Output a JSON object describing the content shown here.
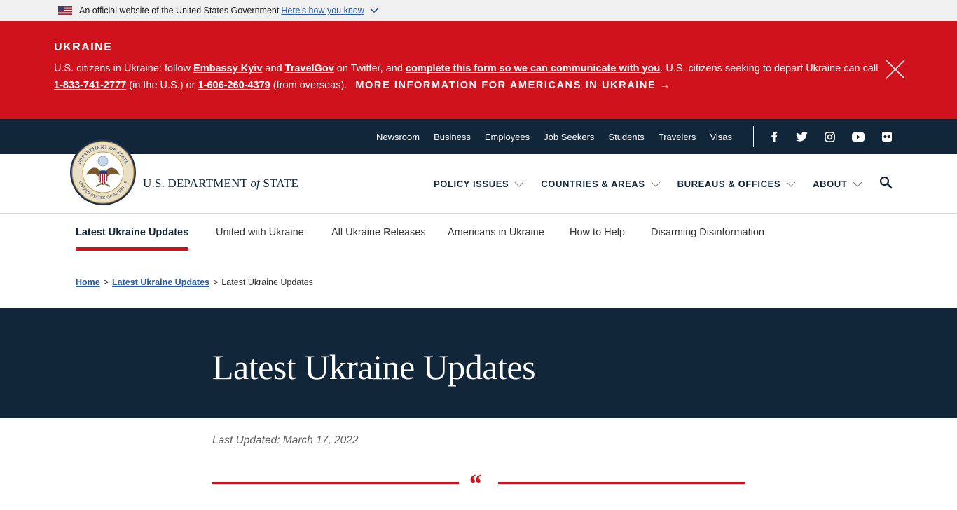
{
  "gov_banner": {
    "text": "An official website of the United States Government",
    "link_label": "Here's how you know"
  },
  "alert": {
    "title": "UKRAINE",
    "intro": "U.S. citizens in Ukraine: follow ",
    "link_embassy": "Embassy Kyiv",
    "and": " and ",
    "link_travelgov": "TravelGov",
    "on_twitter": " on Twitter, and ",
    "link_form": "complete this form so we can communicate with you",
    "depart_text": ". U.S. citizens seeking to depart Ukraine can call ",
    "phone_us": "1-833-741-2777",
    "in_us": " (in the U.S.) or ",
    "phone_overseas": "1-606-260-4379",
    "from_overseas": " (from overseas).",
    "more_link": "MORE INFORMATION FOR AMERICANS IN UKRAINE →"
  },
  "utility_nav": [
    "Newsroom",
    "Business",
    "Employees",
    "Job Seekers",
    "Students",
    "Travelers",
    "Visas"
  ],
  "social": [
    "facebook-icon",
    "twitter-icon",
    "instagram-icon",
    "youtube-icon",
    "flickr-icon"
  ],
  "header": {
    "site_name_pre": "U.S. DEPARTMENT ",
    "site_name_of": "of",
    "site_name_post": " STATE",
    "seal_text_top": "DEPARTMENT OF STATE",
    "seal_text_bottom": "UNITED STATES OF AMERICA"
  },
  "main_nav": [
    "POLICY ISSUES",
    "COUNTRIES & AREAS",
    "BUREAUS & OFFICES",
    "ABOUT"
  ],
  "section_tabs": [
    "Latest Ukraine Updates",
    "United with Ukraine",
    "All Ukraine Releases",
    "Americans in Ukraine",
    "How to Help",
    "Disarming Disinformation"
  ],
  "breadcrumb": {
    "home": "Home",
    "parent": "Latest Ukraine Updates",
    "current": "Latest Ukraine Updates",
    "separator": ">"
  },
  "page_title": "Latest Ukraine Updates",
  "last_updated": "Last Updated: March 17, 2022",
  "quote_mark": "“",
  "colors": {
    "alert_red": "#d0121c",
    "navy": "#12263a",
    "link_blue": "#2a5ba8"
  }
}
